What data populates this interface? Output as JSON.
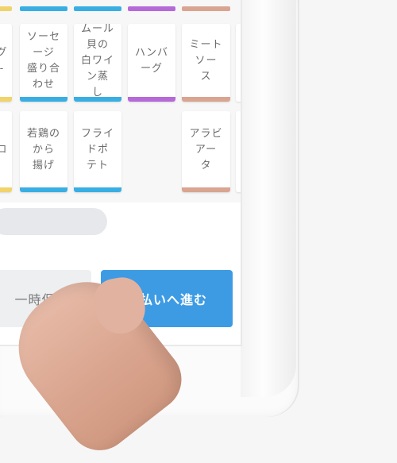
{
  "menu": {
    "row1": [
      {
        "label": "グ\n-",
        "color": "#f0d36a"
      },
      {
        "label": "ソーセージ\n盛り合わせ",
        "color": "#39aee3"
      },
      {
        "label": "ムール貝の\n白ワイン蒸\nし",
        "color": "#39aee3"
      },
      {
        "label": "ハンバーグ",
        "color": "#b56ad8"
      },
      {
        "label": "ミートソー\nス",
        "color": "#d9a490"
      }
    ],
    "row2": [
      {
        "label": "ロ",
        "color": "#f0d36a"
      },
      {
        "label": "若鶏のから\n揚げ",
        "color": "#39aee3"
      },
      {
        "label": "フライドポ\nテト",
        "color": "#39aee3"
      },
      {
        "label": "",
        "color": ""
      },
      {
        "label": "アラビアー\nタ",
        "color": "#d9a490"
      }
    ]
  },
  "actions": {
    "save_label": "一時保存",
    "pay_label": "支払いへ進む"
  },
  "colors": {
    "accent": "#3d9be4",
    "yellow": "#f0d36a",
    "blue": "#39aee3",
    "purple": "#b56ad8",
    "salmon": "#d9a490"
  }
}
